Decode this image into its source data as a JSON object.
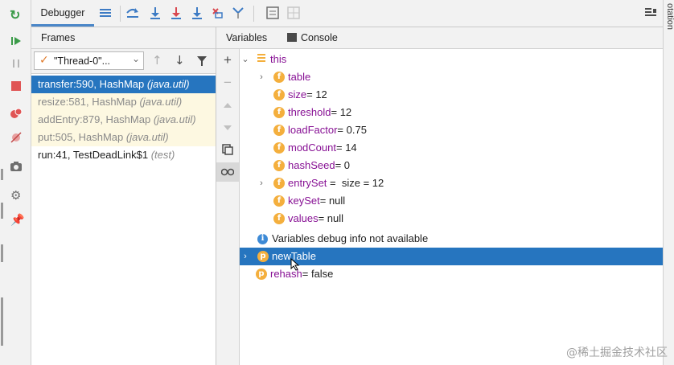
{
  "toolbar": {
    "debugger_tab": "Debugger"
  },
  "frames_panel": {
    "tab_label": "Frames",
    "thread_selector": "\"Thread-0\"...",
    "frames": [
      {
        "method": "transfer:590, HashMap",
        "package": "(java.util)",
        "selected": true
      },
      {
        "method": "resize:581, HashMap",
        "package": "(java.util)",
        "selected": false
      },
      {
        "method": "addEntry:879, HashMap",
        "package": "(java.util)",
        "selected": false
      },
      {
        "method": "put:505, HashMap",
        "package": "(java.util)",
        "selected": false
      },
      {
        "method": "run:41, TestDeadLink$1",
        "package": "(test)",
        "selected": false
      }
    ]
  },
  "variables_panel": {
    "tab_variables": "Variables",
    "tab_console": "Console",
    "root": "this",
    "fields": [
      {
        "icon": "f",
        "name": "table",
        "value": "",
        "expandable": true
      },
      {
        "icon": "f",
        "name": "size",
        "value": " = 12",
        "expandable": false
      },
      {
        "icon": "f",
        "name": "threshold",
        "value": " = 12",
        "expandable": false
      },
      {
        "icon": "f",
        "name": "loadFactor",
        "value": " = 0.75",
        "expandable": false
      },
      {
        "icon": "f",
        "name": "modCount",
        "value": " = 14",
        "expandable": false
      },
      {
        "icon": "f",
        "name": "hashSeed",
        "value": " = 0",
        "expandable": false
      },
      {
        "icon": "f",
        "name": "entrySet",
        "value": " =  size = 12",
        "expandable": true
      },
      {
        "icon": "f",
        "name": "keySet",
        "value": " = null",
        "expandable": false
      },
      {
        "icon": "f",
        "name": "values",
        "value": " = null",
        "expandable": false
      }
    ],
    "info_message": "Variables debug info not available",
    "params": [
      {
        "icon": "p",
        "name": "newTable",
        "value": "",
        "selected": true
      },
      {
        "icon": "p",
        "name": "rehash",
        "value": " = false",
        "selected": false
      }
    ]
  },
  "right_strip_label": "otation",
  "watermark": "@稀土掘金技术社区",
  "colors": {
    "selection": "#2675bf",
    "frame_highlight": "#fdf8e1",
    "field_icon": "#f4af3d"
  }
}
